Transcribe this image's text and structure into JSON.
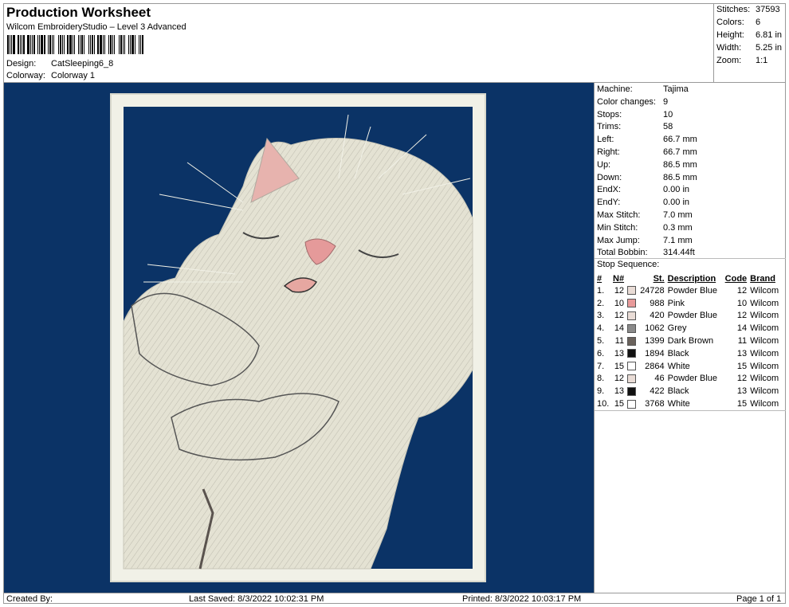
{
  "header": {
    "title": "Production Worksheet",
    "subtitle": "Wilcom EmbroideryStudio – Level 3 Advanced",
    "design_label": "Design:",
    "design_value": "CatSleeping6_8",
    "colorway_label": "Colorway:",
    "colorway_value": "Colorway 1"
  },
  "stats": {
    "stitches_label": "Stitches:",
    "stitches_value": "37593",
    "colors_label": "Colors:",
    "colors_value": "6",
    "height_label": "Height:",
    "height_value": "6.81 in",
    "width_label": "Width:",
    "width_value": "5.25 in",
    "zoom_label": "Zoom:",
    "zoom_value": "1:1"
  },
  "machine_info": [
    {
      "label": "Machine:",
      "value": "Tajima"
    },
    {
      "label": "Color changes:",
      "value": "9"
    },
    {
      "label": "Stops:",
      "value": "10"
    },
    {
      "label": "Trims:",
      "value": "58"
    },
    {
      "label": "Left:",
      "value": "66.7 mm"
    },
    {
      "label": "Right:",
      "value": "66.7 mm"
    },
    {
      "label": "Up:",
      "value": "86.5 mm"
    },
    {
      "label": "Down:",
      "value": "86.5 mm"
    },
    {
      "label": "EndX:",
      "value": "0.00 in"
    },
    {
      "label": "EndY:",
      "value": "0.00 in"
    },
    {
      "label": "Max Stitch:",
      "value": "7.0 mm"
    },
    {
      "label": "Min Stitch:",
      "value": "0.3 mm"
    },
    {
      "label": "Max Jump:",
      "value": "7.1 mm"
    },
    {
      "label": "Total Bobbin:",
      "value": "314.44ft"
    }
  ],
  "stop_sequence": {
    "title": "Stop Sequence:",
    "headers": {
      "idx": "#",
      "needle": "N#",
      "stitches": "St.",
      "description": "Description",
      "code": "Code",
      "brand": "Brand"
    },
    "rows": [
      {
        "idx": "1.",
        "needle": "12",
        "color": "#e9dcd6",
        "stitches": "24728",
        "description": "Powder Blue",
        "code": "12",
        "brand": "Wilcom"
      },
      {
        "idx": "2.",
        "needle": "10",
        "color": "#e89a9a",
        "stitches": "988",
        "description": "Pink",
        "code": "10",
        "brand": "Wilcom"
      },
      {
        "idx": "3.",
        "needle": "12",
        "color": "#e9dcd6",
        "stitches": "420",
        "description": "Powder Blue",
        "code": "12",
        "brand": "Wilcom"
      },
      {
        "idx": "4.",
        "needle": "14",
        "color": "#8a8a8a",
        "stitches": "1062",
        "description": "Grey",
        "code": "14",
        "brand": "Wilcom"
      },
      {
        "idx": "5.",
        "needle": "11",
        "color": "#6a625c",
        "stitches": "1399",
        "description": "Dark Brown",
        "code": "11",
        "brand": "Wilcom"
      },
      {
        "idx": "6.",
        "needle": "13",
        "color": "#111111",
        "stitches": "1894",
        "description": "Black",
        "code": "13",
        "brand": "Wilcom"
      },
      {
        "idx": "7.",
        "needle": "15",
        "color": "#ffffff",
        "stitches": "2864",
        "description": "White",
        "code": "15",
        "brand": "Wilcom"
      },
      {
        "idx": "8.",
        "needle": "12",
        "color": "#e9dcd6",
        "stitches": "46",
        "description": "Powder Blue",
        "code": "12",
        "brand": "Wilcom"
      },
      {
        "idx": "9.",
        "needle": "13",
        "color": "#111111",
        "stitches": "422",
        "description": "Black",
        "code": "13",
        "brand": "Wilcom"
      },
      {
        "idx": "10.",
        "needle": "15",
        "color": "#ffffff",
        "stitches": "3768",
        "description": "White",
        "code": "15",
        "brand": "Wilcom"
      }
    ]
  },
  "footer": {
    "created": "Created By:",
    "saved": "Last Saved: 8/3/2022 10:02:31 PM",
    "printed": "Printed: 8/3/2022 10:03:17 PM",
    "page": "Page 1 of 1"
  },
  "colors": {
    "design_background": "#0b3366",
    "frame": "#eeeee2",
    "fur": "#e6e4d6",
    "nose": "#e59a9a"
  }
}
